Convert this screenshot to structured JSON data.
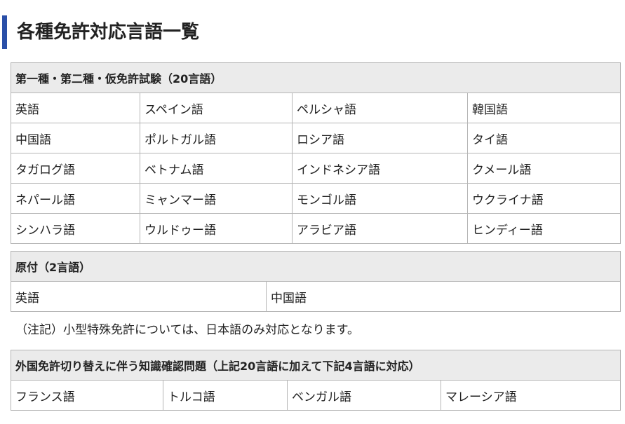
{
  "page_title": "各種免許対応言語一覧",
  "tables": [
    {
      "header": "第一種・第二種・仮免許試験（20言語）",
      "rows": [
        [
          "英語",
          "スペイン語",
          "ペルシャ語",
          "韓国語"
        ],
        [
          "中国語",
          "ポルトガル語",
          "ロシア語",
          "タイ語"
        ],
        [
          "タガログ語",
          "ベトナム語",
          "インドネシア語",
          "クメール語"
        ],
        [
          "ネパール語",
          "ミャンマー語",
          "モンゴル語",
          "ウクライナ語"
        ],
        [
          "シンハラ語",
          "ウルドゥー語",
          "アラビア語",
          "ヒンディー語"
        ]
      ]
    },
    {
      "header": "原付（2言語）",
      "rows": [
        [
          "英語",
          "中国語"
        ]
      ]
    },
    {
      "header": "外国免許切り替えに伴う知識確認問題（上記20言語に加えて下記4言語に対応）",
      "rows": [
        [
          "フランス語",
          "トルコ語",
          "ベンガル語",
          "マレーシア語"
        ]
      ]
    }
  ],
  "note": "（注記）小型特殊免許については、日本語のみ対応となります。"
}
